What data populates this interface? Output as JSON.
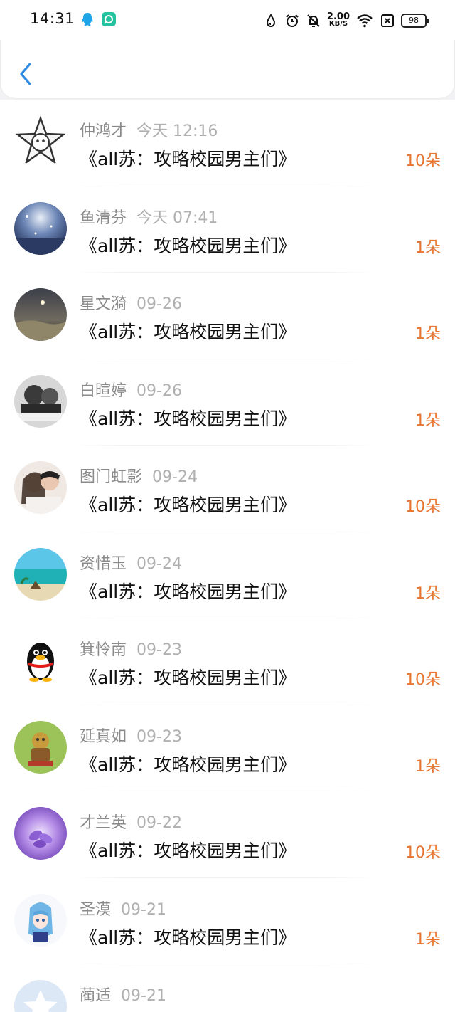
{
  "status_bar": {
    "time": "14:31",
    "net_speed_value": "2.00",
    "net_speed_unit": "KB/S",
    "battery": "98",
    "icons": [
      "qq-icon",
      "app-icon",
      "water-drop-icon",
      "alarm-icon",
      "mute-icon",
      "wifi-icon",
      "sim-icon",
      "battery-icon"
    ]
  },
  "nav": {
    "back_icon": "chevron-left-icon",
    "accent": "#2d8ce6"
  },
  "colors": {
    "flower_count": "#e8752f"
  },
  "items": [
    {
      "name": "仲鸿才",
      "time": "今天 12:16",
      "title": "《all苏：攻略校园男主们》",
      "flowers": "10朵",
      "avatar": "star-badge"
    },
    {
      "name": "鱼清芬",
      "time": "今天 07:41",
      "title": "《all苏：攻略校园男主们》",
      "flowers": "1朵",
      "avatar": "snow-night"
    },
    {
      "name": "星文漪",
      "time": "09-26",
      "title": "《all苏：攻略校园男主们》",
      "flowers": "1朵",
      "avatar": "dusk-sky"
    },
    {
      "name": "白暄婷",
      "time": "09-26",
      "title": "《all苏：攻略校园男主们》",
      "flowers": "1朵",
      "avatar": "bw-photo"
    },
    {
      "name": "图门虹影",
      "time": "09-24",
      "title": "《all苏：攻略校园男主们》",
      "flowers": "10朵",
      "avatar": "couple"
    },
    {
      "name": "资惜玉",
      "time": "09-24",
      "title": "《all苏：攻略校园男主们》",
      "flowers": "1朵",
      "avatar": "beach"
    },
    {
      "name": "箕怜南",
      "time": "09-23",
      "title": "《all苏：攻略校园男主们》",
      "flowers": "10朵",
      "avatar": "penguin"
    },
    {
      "name": "延真如",
      "time": "09-23",
      "title": "《all苏：攻略校园男主们》",
      "flowers": "1朵",
      "avatar": "mech-toy"
    },
    {
      "name": "才兰英",
      "time": "09-22",
      "title": "《all苏：攻略校园男主们》",
      "flowers": "10朵",
      "avatar": "purple-flower"
    },
    {
      "name": "圣漠",
      "time": "09-21",
      "title": "《all苏：攻略校园男主们》",
      "flowers": "1朵",
      "avatar": "anime-girl"
    },
    {
      "name": "蔺适",
      "time": "09-21",
      "title": "",
      "flowers": "",
      "avatar": "default-star"
    }
  ]
}
